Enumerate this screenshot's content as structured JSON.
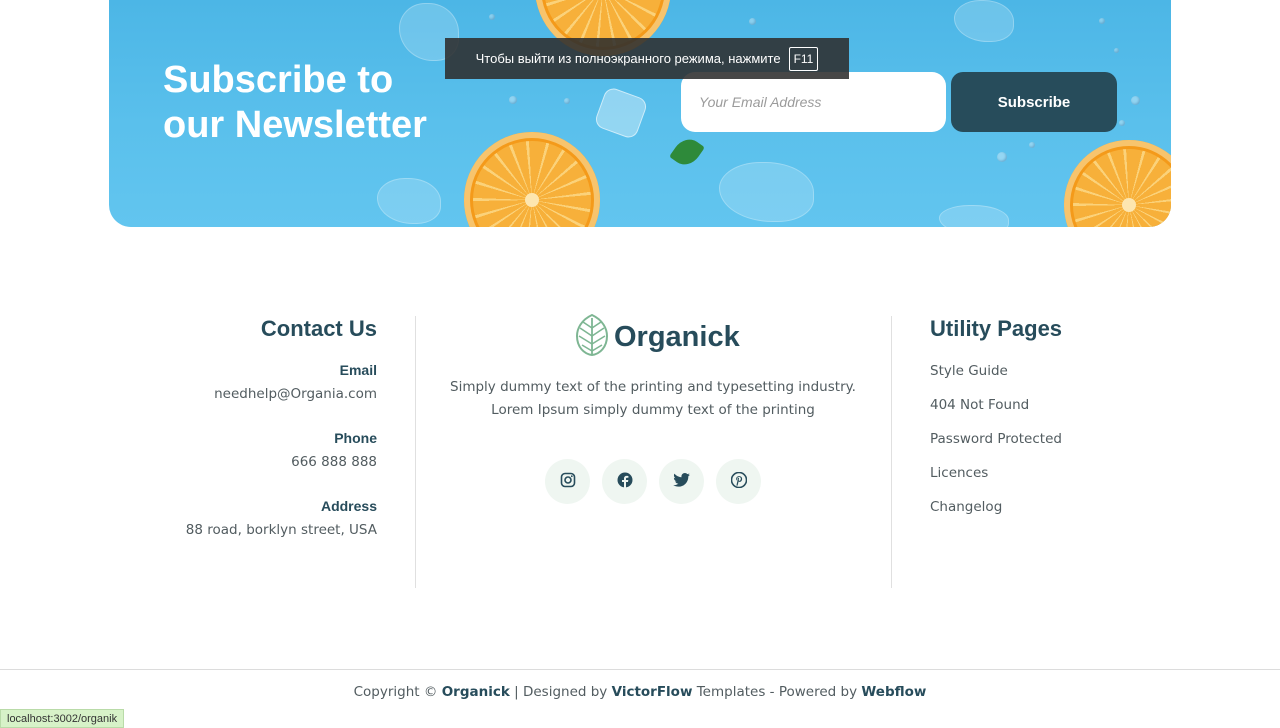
{
  "newsletter": {
    "title": "Subscribe to our Newsletter",
    "email_placeholder": "Your Email Address",
    "subscribe_label": "Subscribe"
  },
  "fullscreen_notice": {
    "text": "Чтобы выйти из полноэкранного режима, нажмите",
    "key": "F11"
  },
  "contact": {
    "title": "Contact Us",
    "email_label": "Email",
    "email_value": "needhelp@Organia.com",
    "phone_label": "Phone",
    "phone_value": "666 888 888",
    "address_label": "Address",
    "address_value": "88 road, borklyn street, USA"
  },
  "brand": {
    "name": "Organick",
    "description": "Simply dummy text of the printing and typesetting industry. Lorem Ipsum simply dummy text of the printing"
  },
  "socials": [
    {
      "icon": "instagram-icon"
    },
    {
      "icon": "facebook-icon"
    },
    {
      "icon": "twitter-icon"
    },
    {
      "icon": "pinterest-icon"
    }
  ],
  "utility": {
    "title": "Utility Pages",
    "links": [
      "Style Guide",
      "404 Not Found",
      "Password Protected",
      "Licences",
      "Changelog"
    ]
  },
  "copyright": {
    "prefix": "Copyright ©",
    "brand": "Organick",
    "designed_by": "| Designed by",
    "designer": "VictorFlow",
    "templates": "Templates - Powered by",
    "platform": "Webflow"
  },
  "status_bar": {
    "url": "localhost:3002/organik"
  },
  "colors": {
    "primary": "#274c5b",
    "banner": "#5ac0ec",
    "text_muted": "#525c60",
    "social_bg": "#eff6f1",
    "logo_green": "#7eb693"
  }
}
